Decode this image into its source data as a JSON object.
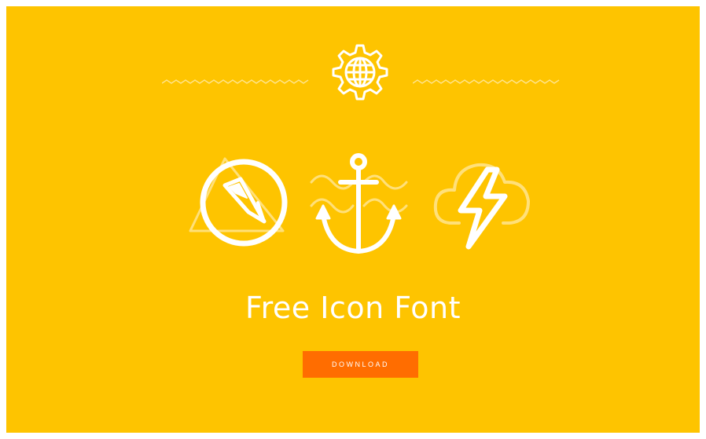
{
  "hero": {
    "title": "Free Icon Font",
    "download_label": "DOWNLOAD"
  },
  "icons": {
    "top": "globe-gear-icon",
    "main": [
      "compass-icon",
      "anchor-icon",
      "lightning-cloud-icon"
    ],
    "background": [
      "mountain-icon",
      "waves-icon",
      "cloud-icon"
    ]
  },
  "colors": {
    "background": "#fec400",
    "accent": "#ff6d00",
    "icon": "#ffffff"
  }
}
